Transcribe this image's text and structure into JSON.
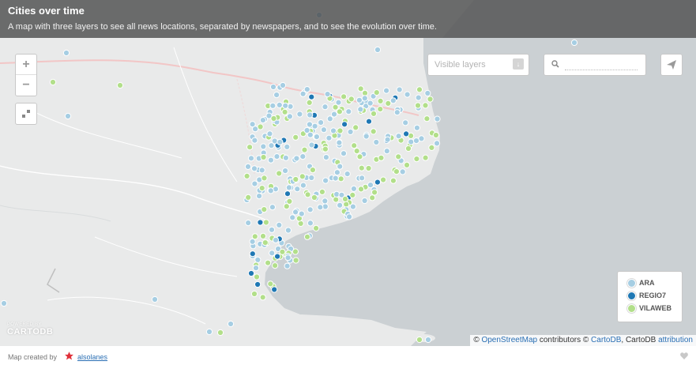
{
  "header": {
    "title": "Cities over time",
    "description": "A map with three layers to see all news locations, separated by newspapers, and to see the evolution over time."
  },
  "controls": {
    "zoom_in": "+",
    "zoom_out": "−",
    "layers_label": "Visible layers",
    "layers_toggle": "↓",
    "search_placeholder": ""
  },
  "legend": {
    "items": [
      {
        "label": "ARA",
        "color": "#a6cee3"
      },
      {
        "label": "REGIO7",
        "color": "#1f78b4"
      },
      {
        "label": "VILAWEB",
        "color": "#b2df8a"
      }
    ]
  },
  "colors": {
    "land": "#e9eaea",
    "sea": "#cbd0d3",
    "ara": "#a6cee3",
    "regio7": "#1f78b4",
    "vilaweb": "#b2df8a",
    "border": "#f2c6c6"
  },
  "logo": {
    "powered": "POWERED BY",
    "name": "CARTODB"
  },
  "attribution": {
    "prefix": "© ",
    "osm": "OpenStreetMap",
    "mid": " contributors © ",
    "cartodb": "CartoDB",
    "mid2": ", CartoDB ",
    "attr": "attribution"
  },
  "footer": {
    "created_by": "Map created by",
    "author": "alsolanes"
  }
}
